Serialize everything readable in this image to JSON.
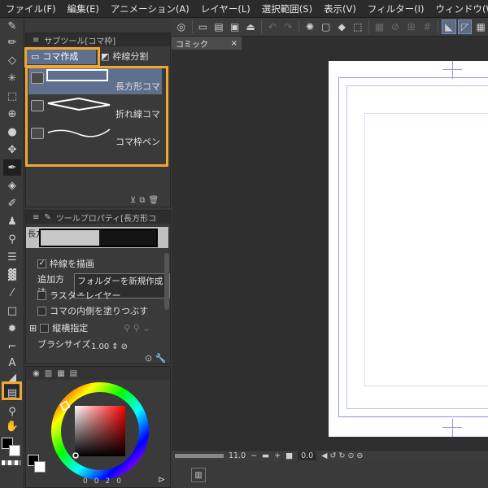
{
  "menu": [
    "ファイル(F)",
    "編集(E)",
    "アニメーション(A)",
    "レイヤー(L)",
    "選択範囲(S)",
    "表示(V)",
    "フィルター(I)",
    "ウィンドウ(W"
  ],
  "subtool": {
    "title": "サブツール[コマ枠]",
    "tabs": [
      "コマ作成",
      "枠線分割"
    ],
    "items": [
      "長方形コマ",
      "折れ線コマ",
      "コマ枠ペン"
    ]
  },
  "toolprop": {
    "title": "ツールプロパティ[長方形コ",
    "preview_label": "長方形コマ",
    "draw_border_label": "枠線を描画",
    "draw_border_checked": true,
    "add_method_label": "追加方法",
    "add_method_value": "フォルダーを新規作成",
    "raster_layer_label": "ラスターレイヤー",
    "fill_inside_label": "コマの内側を塗りつぶす",
    "vertical_horizontal_label": "縦横指定",
    "brush_size_label": "ブラシサイズ",
    "brush_size_value": "1.00"
  },
  "document": {
    "tab_label": "コミック",
    "close_glyph": "×"
  },
  "status": {
    "zoom": "11.0",
    "angle": "0.0"
  },
  "color": {
    "r": "0",
    "g": "0",
    "b": "2",
    "a": "0"
  },
  "colors": {
    "highlight": "#f0a732",
    "tab_active": "#5f6f8e",
    "canvas_bg": "#2f2f2f",
    "page": "#ffffff",
    "guide": "#8f96e6"
  }
}
